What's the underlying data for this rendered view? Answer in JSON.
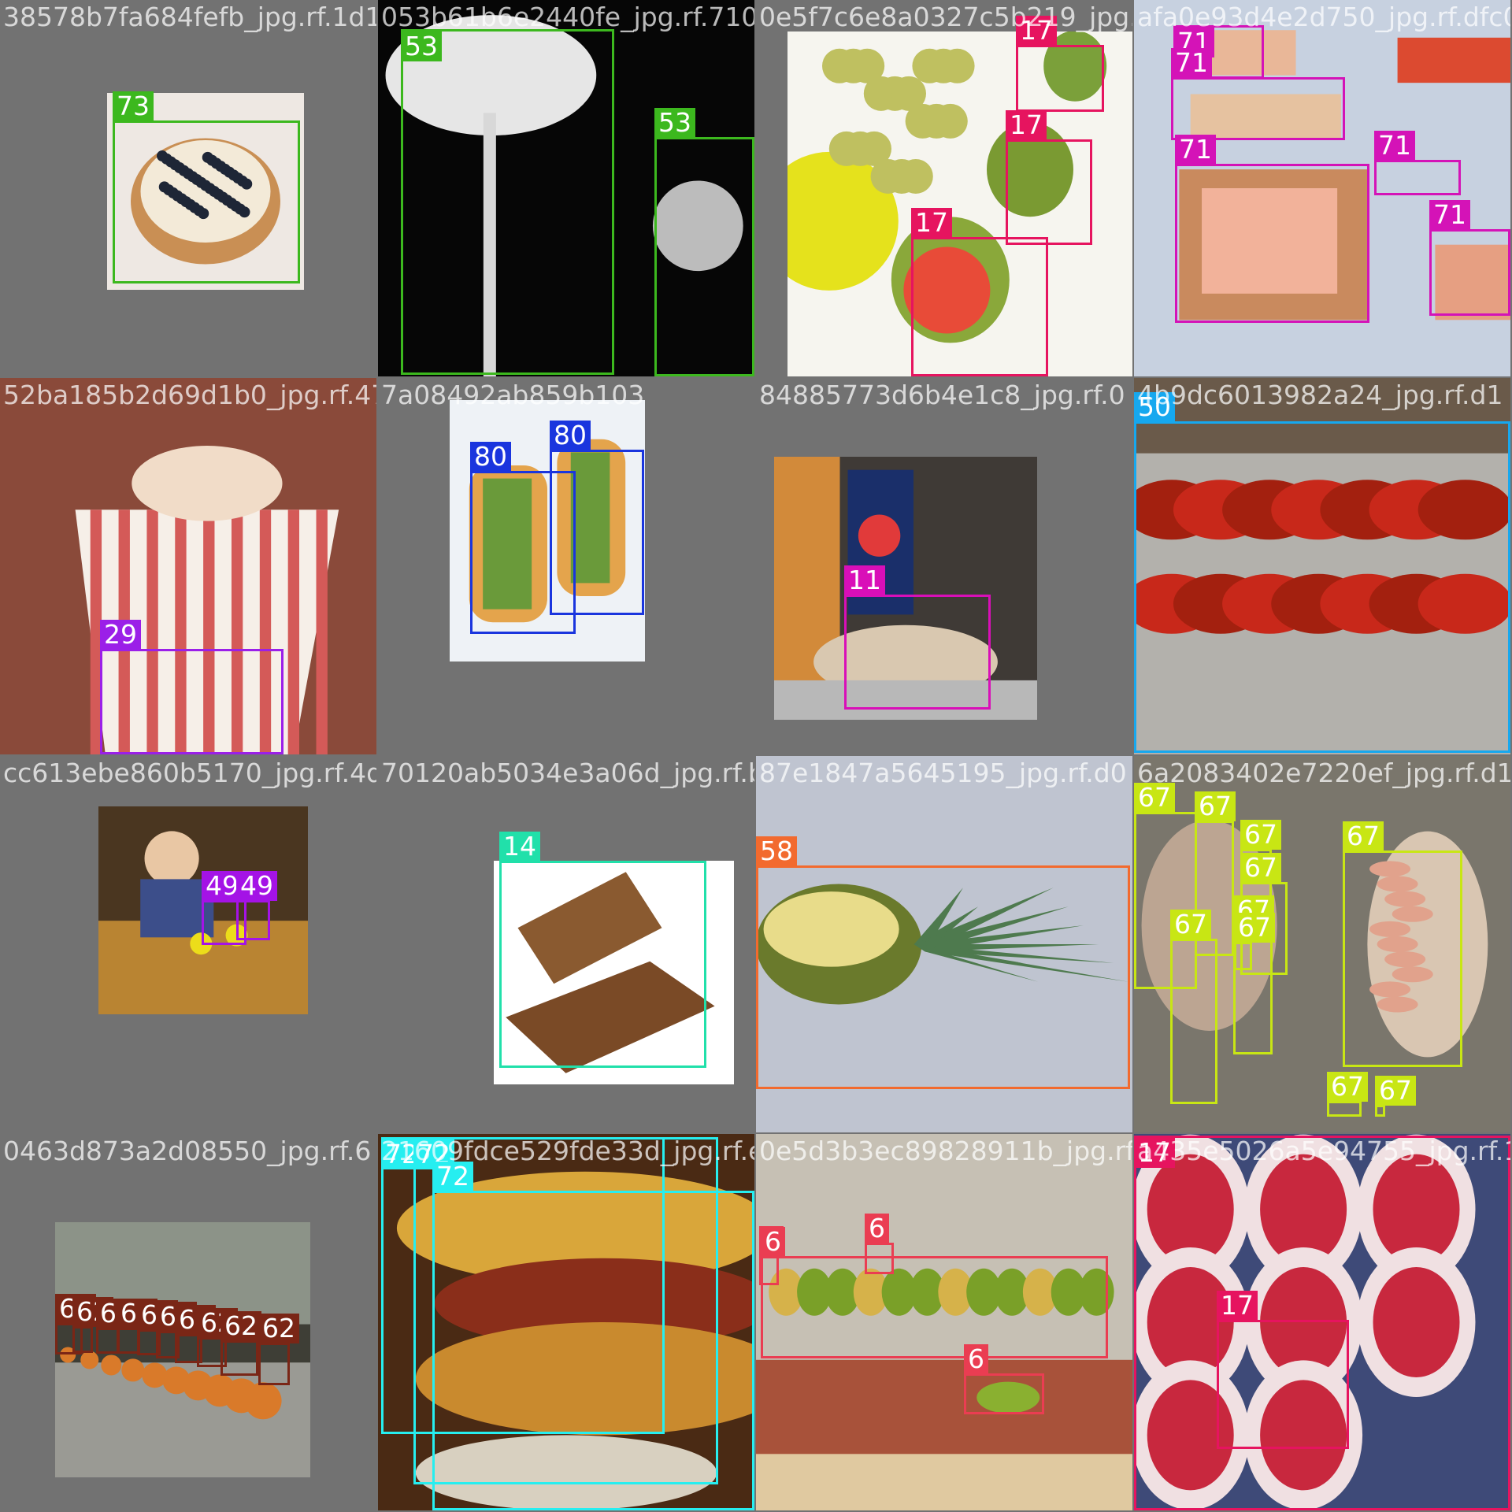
{
  "colors": {
    "background": "#727272",
    "class_73": "#3cb81e",
    "class_53": "#3cb81e",
    "class_17": "#e6145f",
    "class_71": "#d413b7",
    "class_29": "#9b1fe8",
    "class_80": "#1a35de",
    "class_11": "#d90fb8",
    "class_50": "#16a8ef",
    "class_49": "#a413e6",
    "class_14": "#21e0aa",
    "class_58": "#f26a2e",
    "class_67": "#c8e614",
    "class_62": "#7a2616",
    "class_72": "#26eef0",
    "class_6": "#ea3d52"
  },
  "tiles": [
    {
      "filename": "38578b7fa684fefb_jpg.rf.1d10",
      "scene": "blueberry-tart",
      "photo_color": "#efe8e2",
      "boxes": [
        {
          "label": "73",
          "color": "#3cb81e"
        }
      ]
    },
    {
      "filename": "053b61b6e2440fe_jpg.rf.710e",
      "scene": "white-mushroom",
      "photo_color": "#0a0a0a",
      "boxes": [
        {
          "label": "53",
          "color": "#3cb81e"
        },
        {
          "label": "53",
          "color": "#3cb81e"
        }
      ]
    },
    {
      "filename": "0e5f7c6e8a0327c5b219_jpg.rf.e7a9f7",
      "scene": "figs-and-grapes",
      "photo_color": "#f4f3ec",
      "boxes": [
        {
          "label": "17",
          "color": "#e6145f"
        },
        {
          "label": "17",
          "color": "#e6145f"
        },
        {
          "label": "17",
          "color": "#e6145f"
        }
      ]
    },
    {
      "filename": "afa0e93d4e2d750_jpg.rf.dfc0",
      "scene": "salmon-sushi-rolls",
      "photo_color": "#c9d3e2",
      "boxes": [
        {
          "label": "71",
          "color": "#d413b7"
        },
        {
          "label": "71",
          "color": "#d413b7"
        },
        {
          "label": "71",
          "color": "#d413b7"
        },
        {
          "label": "71",
          "color": "#d413b7"
        },
        {
          "label": "71",
          "color": "#d413b7"
        }
      ]
    },
    {
      "filename": "52ba185b2d69d1b0_jpg.rf.47b0",
      "scene": "popcorn-bucket",
      "photo_color": "#8c4c3c",
      "boxes": [
        {
          "label": "29",
          "color": "#9b1fe8"
        }
      ]
    },
    {
      "filename": "7a08492ab859b103",
      "scene": "banh-mi-sandwiches",
      "photo_color": "#e9eef4",
      "boxes": [
        {
          "label": "80",
          "color": "#1a35de"
        },
        {
          "label": "80",
          "color": "#1a35de"
        }
      ]
    },
    {
      "filename": "84885773d6b4e1c8_jpg.rf.0",
      "scene": "burrito-and-pepsi",
      "photo_color": "#4a4540",
      "boxes": [
        {
          "label": "11",
          "color": "#d90fb8"
        }
      ]
    },
    {
      "filename": "4b9dc6013982a24_jpg.rf.d1",
      "scene": "red-lobsters",
      "photo_color": "#8e2a18",
      "boxes": [
        {
          "label": "50",
          "color": "#16a8ef"
        }
      ]
    },
    {
      "filename": "cc613ebe860b5170_jpg.rf.4d",
      "scene": "baby-with-lemons",
      "photo_color": "#6a4a22",
      "boxes": [
        {
          "label": "49",
          "color": "#a413e6"
        },
        {
          "label": "49",
          "color": "#a413e6"
        }
      ]
    },
    {
      "filename": "70120ab5034e3a06d_jpg.rf.be",
      "scene": "chocolate-bar",
      "photo_color": "#ffffff",
      "boxes": [
        {
          "label": "14",
          "color": "#21e0aa"
        }
      ]
    },
    {
      "filename": "87e1847a5645195_jpg.rf.d0",
      "scene": "pineapple-half",
      "photo_color": "#c8ccd6",
      "boxes": [
        {
          "label": "58",
          "color": "#f26a2e"
        }
      ]
    },
    {
      "filename": "6a2083402e7220ef_jpg.rf.d1",
      "scene": "shrimp-platters",
      "photo_color": "#6e6a60",
      "boxes": [
        {
          "label": "67",
          "color": "#c8e614"
        },
        {
          "label": "67",
          "color": "#c8e614"
        },
        {
          "label": "67",
          "color": "#c8e614"
        },
        {
          "label": "67",
          "color": "#c8e614"
        },
        {
          "label": "67",
          "color": "#c8e614"
        },
        {
          "label": "67",
          "color": "#c8e614"
        },
        {
          "label": "67",
          "color": "#c8e614"
        },
        {
          "label": "67",
          "color": "#c8e614"
        },
        {
          "label": "67",
          "color": "#c8e614"
        },
        {
          "label": "67",
          "color": "#c8e614"
        }
      ]
    },
    {
      "filename": "0463d873a2d08550_jpg.rf.6",
      "scene": "pumpkins-in-park",
      "photo_color": "#5a5a52",
      "boxes": [
        {
          "label": "62",
          "color": "#7a2616"
        },
        {
          "label": "62",
          "color": "#7a2616"
        },
        {
          "label": "62",
          "color": "#7a2616"
        },
        {
          "label": "62",
          "color": "#7a2616"
        },
        {
          "label": "62",
          "color": "#7a2616"
        },
        {
          "label": "62",
          "color": "#7a2616"
        },
        {
          "label": "62",
          "color": "#7a2616"
        },
        {
          "label": "62",
          "color": "#7a2616"
        },
        {
          "label": "62",
          "color": "#7a2616"
        },
        {
          "label": "62",
          "color": "#7a2616"
        }
      ]
    },
    {
      "filename": "21609fdce529fde33d_jpg.rf.e0",
      "scene": "tacos-closeup",
      "photo_color": "#5a2e16",
      "boxes": [
        {
          "label": "72",
          "color": "#26eef0"
        },
        {
          "label": "72",
          "color": "#26eef0"
        },
        {
          "label": "72",
          "color": "#26eef0"
        }
      ]
    },
    {
      "filename": "0e5d3b3ec89828911b_jpg.rf.d",
      "scene": "market-bananas",
      "photo_color": "#b7b1a6",
      "boxes": [
        {
          "label": "6",
          "color": "#ea3d52"
        },
        {
          "label": "6",
          "color": "#ea3d52"
        },
        {
          "label": "6",
          "color": "#ea3d52"
        },
        {
          "label": "6",
          "color": "#ea3d52"
        }
      ]
    },
    {
      "filename": "a435e5026a5e94755_jpg.rf.13",
      "scene": "sliced-figs",
      "photo_color": "#b02a40",
      "boxes": [
        {
          "label": "17",
          "color": "#e6145f"
        },
        {
          "label": "17",
          "color": "#e6145f"
        }
      ]
    }
  ]
}
